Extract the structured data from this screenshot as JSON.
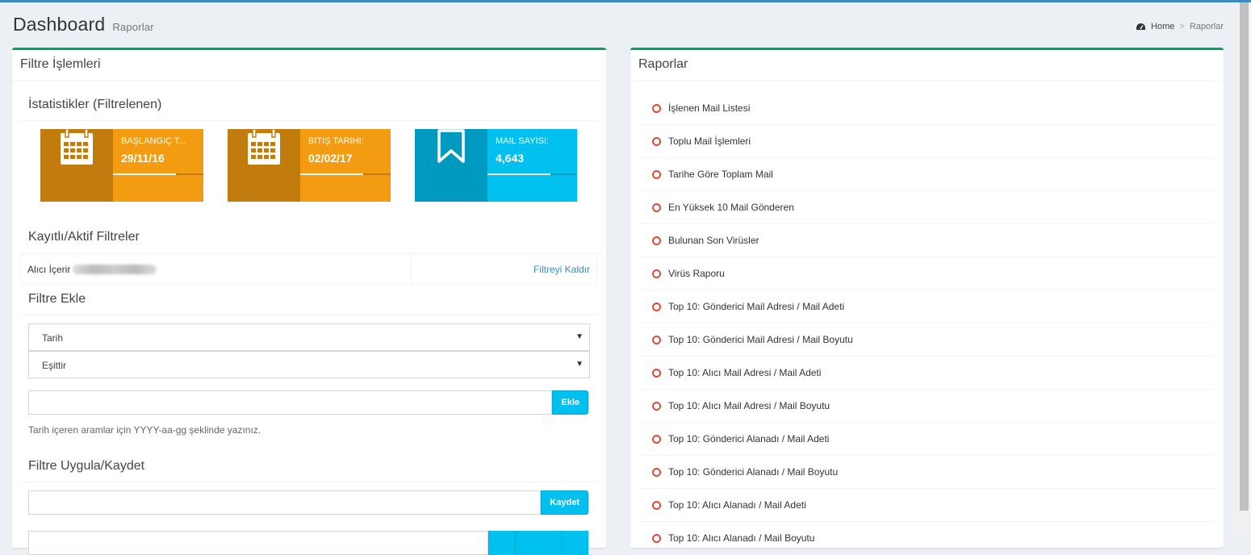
{
  "header": {
    "title": "Dashboard",
    "subtitle": "Raporlar",
    "breadcrumb": {
      "home_icon": "dashboard-icon",
      "home": "Home",
      "separator": ">",
      "current": "Raporlar"
    }
  },
  "colors": {
    "accent_top": "#3c8dbc",
    "box_border": "#00a65a",
    "yellow": "#f39c12",
    "aqua": "#00c0ef",
    "ring": "#dd4b39",
    "link": "#3c8dbc"
  },
  "filter_panel": {
    "title": "Filtre İşlemleri",
    "stats_title": "İstatistikler (Filtrelenen)",
    "stats": [
      {
        "icon": "calendar-icon",
        "label": "BAŞLANGIÇ T...",
        "value": "29/11/16",
        "progress": 0.7
      },
      {
        "icon": "calendar-icon",
        "label": "BITIŞ TARIHI:",
        "value": "02/02/17",
        "progress": 0.7
      },
      {
        "icon": "bookmark-icon",
        "label": "MAIL SAYISI:",
        "value": "4,643",
        "progress": 0.7
      }
    ],
    "saved_title": "Kayıtlı/Aktif Filtreler",
    "active_filter": {
      "label": "Alıcı İçerir",
      "remove": "Filtreyi Kaldır"
    },
    "add_title": "Filtre Ekle",
    "field_select": "Tarih",
    "operator_select": "Eşittir",
    "add_button": "Ekle",
    "add_input": "",
    "help_text": "Tarih içeren aramlar için YYYY-aa-gg şeklinde yazınız.",
    "apply_title": "Filtre Uygula/Kaydet",
    "save_input": "",
    "save_button": "Kaydet"
  },
  "reports_panel": {
    "title": "Raporlar",
    "items": [
      "İşlenen Mail Listesi",
      "Toplu Mail İşlemleri",
      "Tarihe Göre Toplam Mail",
      "En Yüksek 10 Mail Gönderen",
      "Bulunan Son Virüsler",
      "Virüs Raporu",
      "Top 10: Gönderici Mail Adresi / Mail Adeti",
      "Top 10: Gönderici Mail Adresi / Mail Boyutu",
      "Top 10: Alıcı Mail Adresi / Mail Adeti",
      "Top 10: Alıcı Mail Adresi / Mail Boyutu",
      "Top 10: Gönderici Alanadı / Mail Adeti",
      "Top 10: Gönderici Alanadı / Mail Boyutu",
      "Top 10: Alıcı Alanadı / Mail Adeti",
      "Top 10: Alıcı Alanadı / Mail Boyutu"
    ]
  }
}
